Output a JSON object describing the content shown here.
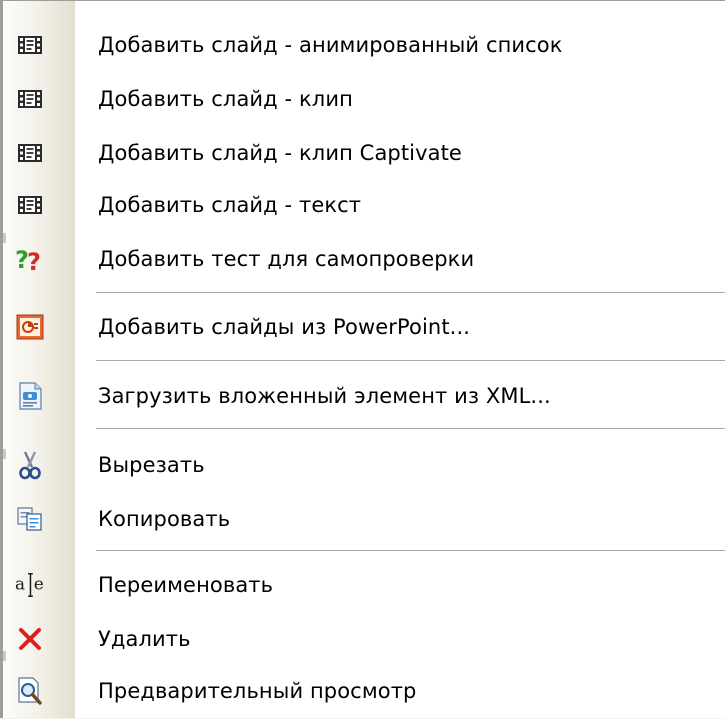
{
  "context_menu": {
    "items": [
      {
        "label": "Добавить слайд - анимированный список",
        "icon": "film-slide-icon"
      },
      {
        "label": "Добавить слайд - клип",
        "icon": "film-slide-icon"
      },
      {
        "label": "Добавить слайд - клип Captivate",
        "icon": "film-slide-icon"
      },
      {
        "label": "Добавить слайд - текст",
        "icon": "film-slide-icon"
      },
      {
        "label": "Добавить тест для самопроверки",
        "icon": "question-marks-icon"
      },
      {
        "label": "Добавить слайды из PowerPoint...",
        "icon": "powerpoint-icon"
      },
      {
        "label": "Загрузить вложенный элемент из XML...",
        "icon": "xml-document-icon"
      },
      {
        "label": "Вырезать",
        "icon": "scissors-icon"
      },
      {
        "label": "Копировать",
        "icon": "copy-icon"
      },
      {
        "label": "Переименовать",
        "icon": "rename-icon"
      },
      {
        "label": "Удалить",
        "icon": "delete-x-icon"
      },
      {
        "label": "Предварительный просмотр",
        "icon": "preview-magnifier-icon"
      }
    ]
  },
  "colors": {
    "delete_icon": "#e02020",
    "question_green": "#2e9e2e",
    "question_red": "#d42a2a"
  }
}
